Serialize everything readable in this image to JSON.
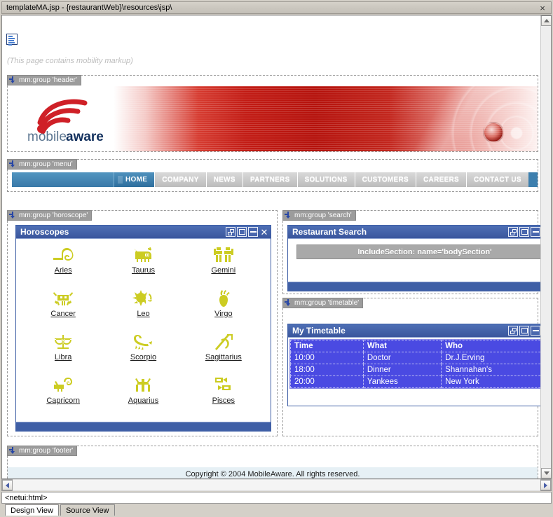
{
  "window": {
    "title": "templateMA.jsp - {restaurantWeb}\\resources\\jsp\\",
    "close_label": "×"
  },
  "editor": {
    "mobility_note": "(This page contains mobility markup)",
    "tag_path": "<netui:html>",
    "view_tabs": [
      {
        "label": "Design View",
        "active": true
      },
      {
        "label": "Source View",
        "active": false
      }
    ]
  },
  "groups": {
    "header": "mm:group 'header'",
    "menu": "mm:group 'menu'",
    "horoscope": "mm:group 'horoscope'",
    "search": "mm:group 'search'",
    "timetable": "mm:group 'timetable'",
    "footer": "mm:group 'footer'"
  },
  "brand": {
    "name_light": "mobile",
    "name_bold": "aware"
  },
  "site_menu": {
    "items": [
      {
        "label": "HOME",
        "active": true
      },
      {
        "label": "COMPANY",
        "active": false
      },
      {
        "label": "NEWS",
        "active": false
      },
      {
        "label": "PARTNERS",
        "active": false
      },
      {
        "label": "SOLUTIONS",
        "active": false
      },
      {
        "label": "CUSTOMERS",
        "active": false
      },
      {
        "label": "CAREERS",
        "active": false
      },
      {
        "label": "CONTACT US",
        "active": false
      }
    ]
  },
  "portlets": {
    "horoscope": {
      "title": "Horoscopes",
      "signs": [
        {
          "name": "Aries",
          "icon": "aries-icon"
        },
        {
          "name": "Taurus",
          "icon": "taurus-icon"
        },
        {
          "name": "Gemini",
          "icon": "gemini-icon"
        },
        {
          "name": "Cancer",
          "icon": "cancer-icon"
        },
        {
          "name": "Leo",
          "icon": "leo-icon"
        },
        {
          "name": "Virgo",
          "icon": "virgo-icon"
        },
        {
          "name": "Libra",
          "icon": "libra-icon"
        },
        {
          "name": "Scorpio",
          "icon": "scorpio-icon"
        },
        {
          "name": "Sagittarius",
          "icon": "sagittarius-icon"
        },
        {
          "name": "Capricorn",
          "icon": "capricorn-icon"
        },
        {
          "name": "Aquarius",
          "icon": "aquarius-icon"
        },
        {
          "name": "Pisces",
          "icon": "pisces-icon"
        }
      ]
    },
    "search": {
      "title": "Restaurant Search",
      "include_section": "IncludeSection: name='bodySection'"
    },
    "timetable": {
      "title": "My Timetable",
      "columns": [
        "Time",
        "What",
        "Who"
      ],
      "rows": [
        [
          "10:00",
          "Doctor",
          "Dr.J.Erving"
        ],
        [
          "18:00",
          "Dinner",
          "Shannahan's"
        ],
        [
          "20:00",
          "Yankees",
          "New York"
        ]
      ]
    }
  },
  "footer": {
    "copyright": "Copyright © 2004 MobileAware. All rights reserved."
  },
  "colors": {
    "portlet_title": "#3a569d",
    "table_blue": "#4a4ae2",
    "zodiac_yellow": "#cccc22",
    "banner_red": "#c21b14",
    "menu_blue": "#3d7fae"
  }
}
